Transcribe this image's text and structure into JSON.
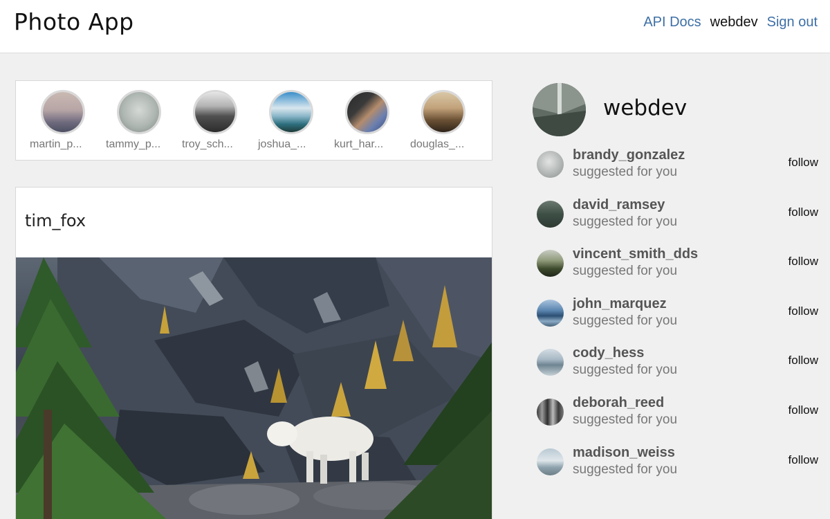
{
  "header": {
    "brand": "Photo App",
    "nav": {
      "api_docs": "API Docs",
      "username": "webdev",
      "sign_out": "Sign out"
    }
  },
  "stories": [
    {
      "username": "martin_p..."
    },
    {
      "username": "tammy_p..."
    },
    {
      "username": "troy_sch..."
    },
    {
      "username": "joshua_..."
    },
    {
      "username": "kurt_har..."
    },
    {
      "username": "douglas_..."
    }
  ],
  "post": {
    "author": "tim_fox"
  },
  "profile": {
    "username": "webdev"
  },
  "suggestions": {
    "items": [
      {
        "username": "brandy_gonzalez",
        "subtitle": "suggested for you",
        "action": "follow"
      },
      {
        "username": "david_ramsey",
        "subtitle": "suggested for you",
        "action": "follow"
      },
      {
        "username": "vincent_smith_dds",
        "subtitle": "suggested for you",
        "action": "follow"
      },
      {
        "username": "john_marquez",
        "subtitle": "suggested for you",
        "action": "follow"
      },
      {
        "username": "cody_hess",
        "subtitle": "suggested for you",
        "action": "follow"
      },
      {
        "username": "deborah_reed",
        "subtitle": "suggested for you",
        "action": "follow"
      },
      {
        "username": "madison_weiss",
        "subtitle": "suggested for you",
        "action": "follow"
      }
    ]
  },
  "colors": {
    "link": "#3d6fa6",
    "page_bg": "#f0f0f0",
    "card_bg": "#ffffff"
  }
}
